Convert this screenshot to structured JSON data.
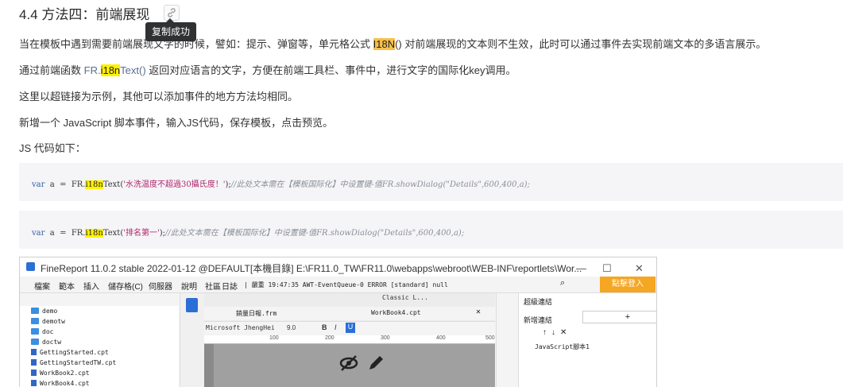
{
  "heading": "4.4 方法四：前端展现",
  "tooltip": "复制成功",
  "para1": {
    "pre": "当在模板中遇到需要前端展现文字的时候，譬如：提示、弹窗等，单元格公式 ",
    "hl": "I18N",
    "post": "() 对前端展现的文本则不生效，此时可以通过事件去实现前端文本的多语言展示。"
  },
  "para2": {
    "pre": "通过前端函数 ",
    "fr": "FR.",
    "hl": "i18n",
    "fn": "Text()",
    "post": " 返回对应语言的文字，方便在前端工具栏、事件中，进行文字的国际化key调用。"
  },
  "para3": "这里以超链接为示例，其他可以添加事件的地方方法均相同。",
  "para4": "新增一个 JavaScript 脚本事件，输入JS代码，保存模板，点击预览。",
  "para5": "JS 代码如下：",
  "code1": {
    "kw": "var",
    "vname": "  a  =  FR.",
    "hl": "i18n",
    "fn": "Text(",
    "str": "'水洗温度不超過30攝氏度！'",
    "close": ");",
    "comment": "//此处文本需在【模板国际化】中设置键-值FR.showDialog(\"Details\",600,400,a);"
  },
  "code2": {
    "kw": "var",
    "vname": "  a  =  FR.",
    "hl": "i18n",
    "fn": "Text(",
    "str": "'排名第一'",
    "close": ");",
    "comment": "//此处文本需在【模板国际化】中设置键-值FR.showDialog(\"Details\",600,400,a);"
  },
  "app": {
    "title": "FineReport 11.0.2 stable 2022-01-12 @DEFAULT[本機目錄]   E:\\FR11.0_TW\\FR11.0\\webapps\\webroot\\WEB-INF\\reportlets\\Wor...",
    "menu": [
      "檔案",
      "範本",
      "插入",
      "儲存格(C)",
      "伺服器",
      "說明",
      "社區",
      "日誌"
    ],
    "status": "| 嚴重 19:47:35 AWT-EventQueue-0 ERROR [standard] null",
    "login": "點擊登入",
    "tree": [
      {
        "type": "folder",
        "name": "demo"
      },
      {
        "type": "folder",
        "name": "demotw"
      },
      {
        "type": "folder",
        "name": "doc"
      },
      {
        "type": "folder",
        "name": "doctw"
      },
      {
        "type": "file",
        "name": "GettingStarted.cpt"
      },
      {
        "type": "file",
        "name": "GettingStartedTW.cpt"
      },
      {
        "type": "file",
        "name": "WorkBook2.cpt"
      },
      {
        "type": "file",
        "name": "WorkBook4.cpt"
      }
    ],
    "tab1": "銷量日報.frm",
    "tab2": "WorkBook4.cpt",
    "theme": "Classic L...",
    "font": "Microsoft JhengHei",
    "size": "9.0",
    "ruler": [
      "100",
      "200",
      "300",
      "400",
      "500"
    ],
    "panel_title": "超級連結",
    "panel_sub": "新增連結",
    "panel_item": "JavaScript腳本1"
  }
}
